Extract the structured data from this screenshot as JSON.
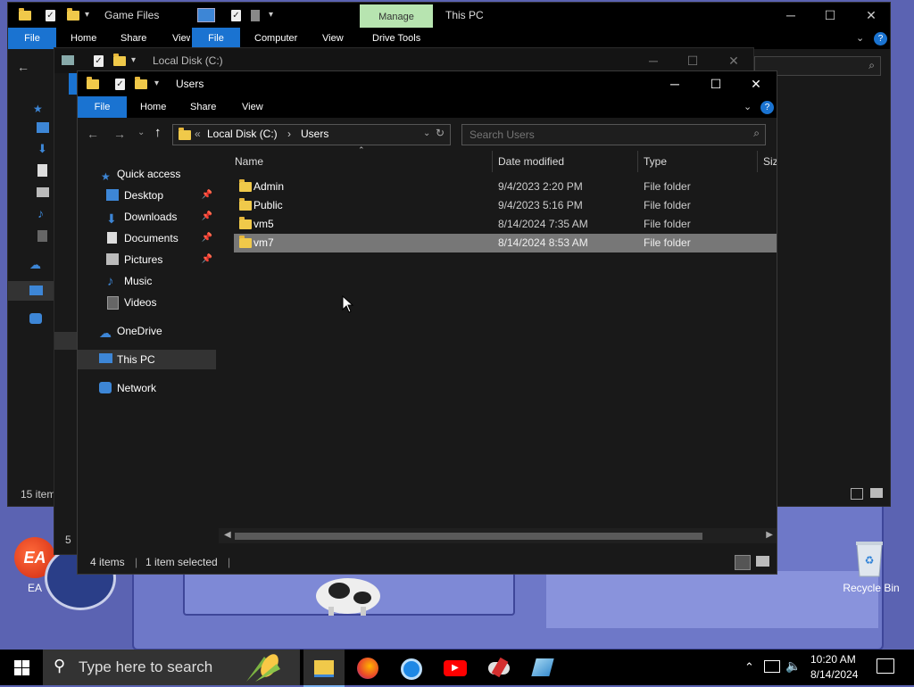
{
  "desktop": {
    "ea_label": "EA",
    "recycle_label": "Recycle Bin"
  },
  "back_window_1": {
    "title": "Game Files",
    "tabs": [
      "File",
      "Home",
      "Share",
      "View"
    ],
    "status": "15 item"
  },
  "back_window_2": {
    "manage_label": "Manage",
    "title": "This PC",
    "tabs": [
      "File",
      "Computer",
      "View",
      "Drive Tools"
    ]
  },
  "back_window_3": {
    "title": "Local Disk (C:)",
    "status": "5"
  },
  "main": {
    "title": "Users",
    "tabs": {
      "file": "File",
      "home": "Home",
      "share": "Share",
      "view": "View"
    },
    "breadcrumb": {
      "overflow": "«",
      "disk": "Local Disk (C:)",
      "sep": "›",
      "folder": "Users"
    },
    "search_placeholder": "Search Users",
    "columns": {
      "name": "Name",
      "date": "Date modified",
      "type": "Type",
      "size": "Siz"
    },
    "nav": {
      "quick_access": "Quick access",
      "desktop": "Desktop",
      "downloads": "Downloads",
      "documents": "Documents",
      "pictures": "Pictures",
      "music": "Music",
      "videos": "Videos",
      "onedrive": "OneDrive",
      "thispc": "This PC",
      "network": "Network"
    },
    "files": [
      {
        "name": "Admin",
        "date": "9/4/2023 2:20 PM",
        "type": "File folder"
      },
      {
        "name": "Public",
        "date": "9/4/2023 5:16 PM",
        "type": "File folder"
      },
      {
        "name": "vm5",
        "date": "8/14/2024 7:35 AM",
        "type": "File folder"
      },
      {
        "name": "vm7",
        "date": "8/14/2024 8:53 AM",
        "type": "File folder"
      }
    ],
    "status_count": "4 items",
    "status_sel": "1 item selected"
  },
  "taskbar": {
    "search_placeholder": "Type here to search",
    "time": "10:20 AM",
    "date": "8/14/2024"
  },
  "colors": {
    "accent": "#1a73d1",
    "manage": "#b7e4b0",
    "selection": "#777777"
  }
}
